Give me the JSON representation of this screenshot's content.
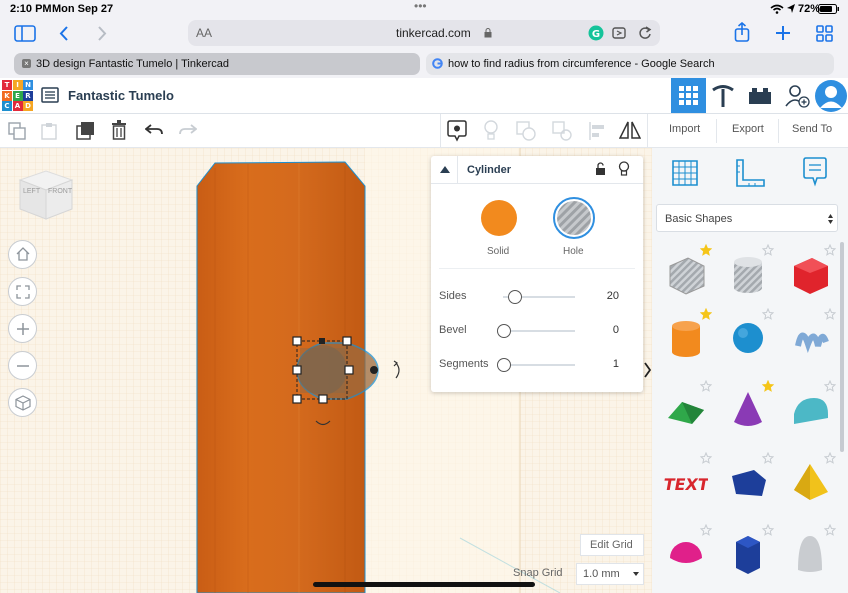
{
  "status_bar": {
    "time": "2:10 PM",
    "date": "Mon Sep 27",
    "battery": "72%",
    "dots": "•••"
  },
  "safari": {
    "aa_label": "AA",
    "url": "tinkercad.com",
    "tabs": [
      {
        "label": "3D design Fantastic Tumelo | Tinkercad",
        "active": true
      },
      {
        "label": "how to find radius from circumference - Google Search",
        "active": false
      }
    ]
  },
  "app": {
    "logo_letters": [
      "T",
      "I",
      "N",
      "K",
      "E",
      "R",
      "C",
      "A",
      "D"
    ],
    "design_title": "Fantastic Tumelo",
    "toolbar": {
      "import": "Import",
      "export": "Export",
      "send_to": "Send To"
    },
    "view_cube": {
      "left": "LEFT",
      "front": "FRONT"
    }
  },
  "inspector": {
    "title": "Cylinder",
    "solid_label": "Solid",
    "hole_label": "Hole",
    "properties": [
      {
        "label": "Sides",
        "value": "20",
        "fraction": 0.15
      },
      {
        "label": "Bevel",
        "value": "0",
        "fraction": 0.0
      },
      {
        "label": "Segments",
        "value": "1",
        "fraction": 0.0
      }
    ]
  },
  "shapes_panel": {
    "category": "Basic Shapes",
    "shapes": [
      {
        "name": "box-hole",
        "color": "#b9bec4",
        "starred": true
      },
      {
        "name": "cylinder-hole",
        "color": "#b9bec4",
        "starred": false
      },
      {
        "name": "box",
        "color": "#e0242c",
        "starred": false
      },
      {
        "name": "cylinder",
        "color": "#f28a1e",
        "starred": true
      },
      {
        "name": "sphere",
        "color": "#1d8fcf",
        "starred": false
      },
      {
        "name": "scribble",
        "color": "#7fa9d6",
        "starred": false
      },
      {
        "name": "roof",
        "color": "#2fa84a",
        "starred": false
      },
      {
        "name": "cone",
        "color": "#8a3ab5",
        "starred": true
      },
      {
        "name": "round-roof",
        "color": "#4cb8c6",
        "starred": false
      },
      {
        "name": "text",
        "color": "#d8262d",
        "starred": false
      },
      {
        "name": "wedge",
        "color": "#1d3e9a",
        "starred": false
      },
      {
        "name": "pyramid",
        "color": "#f1c21b",
        "starred": false
      },
      {
        "name": "half-sphere",
        "color": "#e0208a",
        "starred": false
      },
      {
        "name": "polygon",
        "color": "#1d3e9a",
        "starred": false
      },
      {
        "name": "paraboloid",
        "color": "#c9ccd0",
        "starred": false
      }
    ]
  },
  "workplane": {
    "edit_grid": "Edit Grid",
    "snap_grid_label": "Snap Grid",
    "snap_grid_value": "1.0 mm"
  },
  "colors": {
    "accent_blue": "#2f8fe0",
    "solid_orange": "#f28a1e",
    "object_orange": "#d86a1e"
  }
}
